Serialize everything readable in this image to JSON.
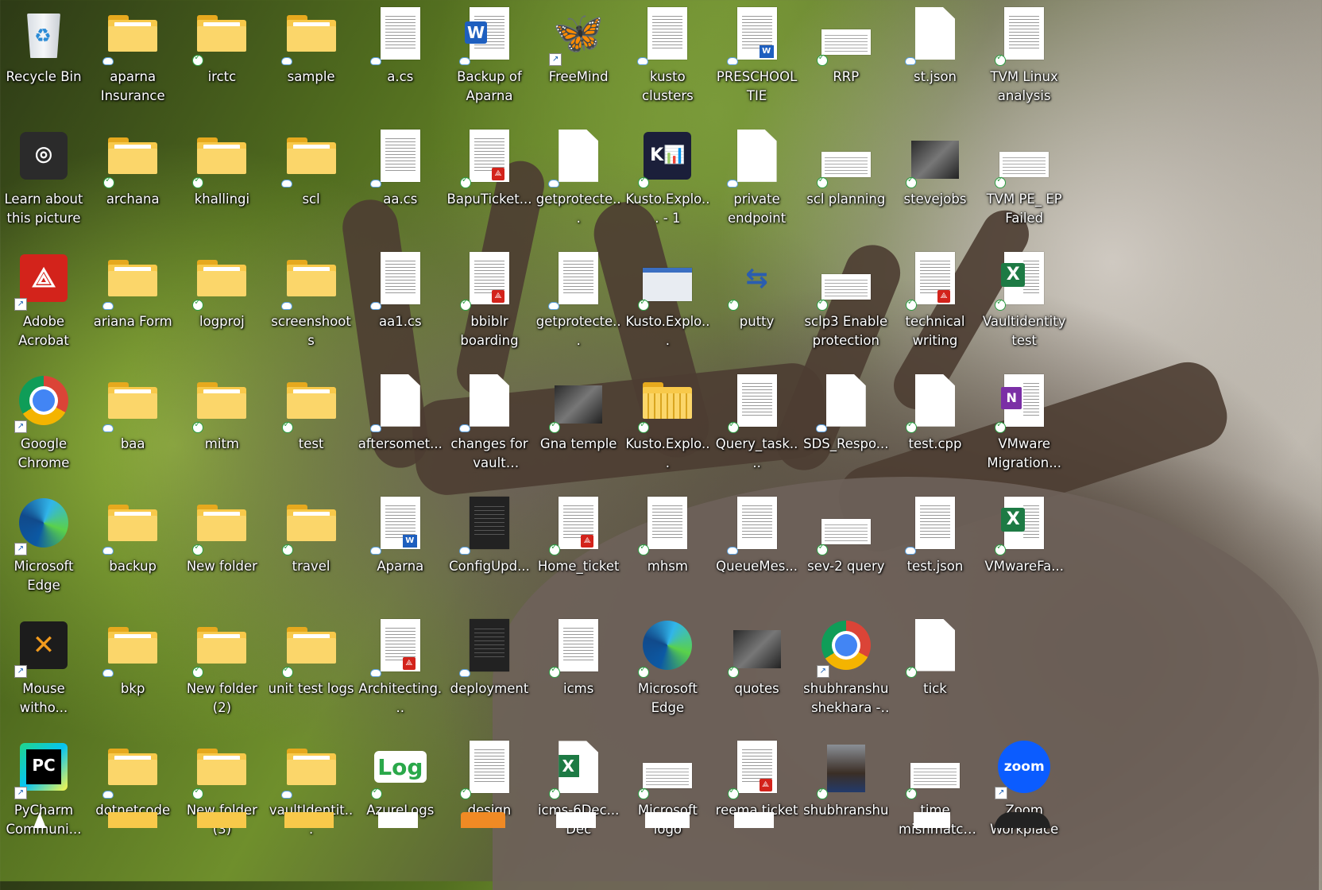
{
  "colors": {
    "label_text": "#ffffff",
    "folder": "#f8c94a",
    "sync_ok": "#2e9e44"
  },
  "icons": [
    {
      "name": "Recycle Bin",
      "type": "recycle",
      "col": 0,
      "row": 0
    },
    {
      "name": "aparna Insurance",
      "type": "folder",
      "col": 1,
      "row": 0,
      "badge": "cloud"
    },
    {
      "name": "irctc",
      "type": "folder",
      "col": 2,
      "row": 0,
      "badge": "ok"
    },
    {
      "name": "sample",
      "type": "folder",
      "col": 3,
      "row": 0,
      "badge": "cloud"
    },
    {
      "name": "a.cs",
      "type": "doc",
      "col": 4,
      "row": 0,
      "badge": "cloud"
    },
    {
      "name": "Backup of Aparna",
      "type": "word",
      "col": 5,
      "row": 0,
      "badge": "cloud"
    },
    {
      "name": "FreeMind",
      "type": "butterfly",
      "col": 6,
      "row": 0,
      "badge": "shortcut"
    },
    {
      "name": "kusto clusters",
      "type": "doc",
      "col": 7,
      "row": 0,
      "badge": "cloud"
    },
    {
      "name": "PRESCHOOL TIE",
      "type": "worddoc",
      "col": 8,
      "row": 0,
      "badge": "cloud"
    },
    {
      "name": "RRP",
      "type": "wide",
      "col": 9,
      "row": 0,
      "badge": "ok"
    },
    {
      "name": "st.json",
      "type": "blank",
      "col": 10,
      "row": 0,
      "badge": "cloud"
    },
    {
      "name": "TVM Linux analysis",
      "type": "doc",
      "col": 11,
      "row": 0,
      "badge": "ok"
    },
    {
      "name": "Learn about this picture",
      "type": "learn",
      "col": 0,
      "row": 1
    },
    {
      "name": "archana",
      "type": "folder",
      "col": 1,
      "row": 1,
      "badge": "ok"
    },
    {
      "name": "khallingi",
      "type": "folder",
      "col": 2,
      "row": 1,
      "badge": "ok"
    },
    {
      "name": "scl",
      "type": "folder",
      "col": 3,
      "row": 1,
      "badge": "cloud"
    },
    {
      "name": "aa.cs",
      "type": "doc",
      "col": 4,
      "row": 1,
      "badge": "cloud"
    },
    {
      "name": "BapuTicket...",
      "type": "pdf",
      "col": 5,
      "row": 1,
      "badge": "ok"
    },
    {
      "name": "getprotecte...",
      "type": "blank",
      "col": 6,
      "row": 1,
      "badge": "cloud"
    },
    {
      "name": "Kusto.Explo... - 1",
      "type": "kusto",
      "col": 7,
      "row": 1,
      "badge": "ok"
    },
    {
      "name": "private endpoint",
      "type": "blank",
      "col": 8,
      "row": 1,
      "badge": "cloud"
    },
    {
      "name": "scl planning",
      "type": "wide",
      "col": 9,
      "row": 1,
      "badge": "ok"
    },
    {
      "name": "stevejobs",
      "type": "photo",
      "col": 10,
      "row": 1,
      "badge": "ok"
    },
    {
      "name": "TVM PE_ EP Failed",
      "type": "wide",
      "col": 11,
      "row": 1,
      "badge": "ok"
    },
    {
      "name": "Adobe Acrobat",
      "type": "acrobat",
      "col": 0,
      "row": 2,
      "badge": "shortcut"
    },
    {
      "name": "ariana Form",
      "type": "folder",
      "col": 1,
      "row": 2,
      "badge": "cloud"
    },
    {
      "name": "logproj",
      "type": "folder",
      "col": 2,
      "row": 2,
      "badge": "ok"
    },
    {
      "name": "screenshoots",
      "type": "folder",
      "col": 3,
      "row": 2,
      "badge": "cloud"
    },
    {
      "name": "aa1.cs",
      "type": "doc",
      "col": 4,
      "row": 2,
      "badge": "cloud"
    },
    {
      "name": "bbiblr boarding",
      "type": "pdf",
      "col": 5,
      "row": 2,
      "badge": "ok"
    },
    {
      "name": "getprotecte...",
      "type": "doc",
      "col": 6,
      "row": 2,
      "badge": "cloud"
    },
    {
      "name": "Kusto.Explo...",
      "type": "window",
      "col": 7,
      "row": 2,
      "badge": "ok"
    },
    {
      "name": "putty",
      "type": "putty",
      "col": 8,
      "row": 2,
      "badge": "ok"
    },
    {
      "name": "sclp3 Enable protection",
      "type": "wide",
      "col": 9,
      "row": 2,
      "badge": "ok"
    },
    {
      "name": "technical writing",
      "type": "pdf",
      "col": 10,
      "row": 2,
      "badge": "ok"
    },
    {
      "name": "Vaultidentity test",
      "type": "excel",
      "col": 11,
      "row": 2,
      "badge": "ok"
    },
    {
      "name": "Google Chrome",
      "type": "chrome",
      "col": 0,
      "row": 3,
      "badge": "shortcut"
    },
    {
      "name": "baa",
      "type": "folder",
      "col": 1,
      "row": 3,
      "badge": "cloud"
    },
    {
      "name": "mitm",
      "type": "folder",
      "col": 2,
      "row": 3,
      "badge": "ok"
    },
    {
      "name": "test",
      "type": "folder",
      "col": 3,
      "row": 3,
      "badge": "ok"
    },
    {
      "name": "aftersomet...",
      "type": "blank",
      "col": 4,
      "row": 3,
      "badge": "cloud"
    },
    {
      "name": "changes for vault identity",
      "type": "blank",
      "col": 5,
      "row": 3,
      "badge": "cloud"
    },
    {
      "name": "Gna temple",
      "type": "photo",
      "col": 6,
      "row": 3,
      "badge": "ok"
    },
    {
      "name": "Kusto.Explo...",
      "type": "zipfolder",
      "col": 7,
      "row": 3,
      "badge": "ok"
    },
    {
      "name": "Query_task....",
      "type": "doc",
      "col": 8,
      "row": 3,
      "badge": "ok"
    },
    {
      "name": "SDS_Respo...",
      "type": "blank",
      "col": 9,
      "row": 3,
      "badge": "cloud"
    },
    {
      "name": "test.cpp",
      "type": "blank",
      "col": 10,
      "row": 3,
      "badge": "ok"
    },
    {
      "name": "VMware Migration...",
      "type": "onenote",
      "col": 11,
      "row": 3,
      "badge": "ok"
    },
    {
      "name": "Microsoft Edge",
      "type": "edge",
      "col": 0,
      "row": 4,
      "badge": "shortcut"
    },
    {
      "name": "backup",
      "type": "folder",
      "col": 1,
      "row": 4,
      "badge": "cloud"
    },
    {
      "name": "New folder",
      "type": "folder",
      "col": 2,
      "row": 4,
      "badge": "ok"
    },
    {
      "name": "travel",
      "type": "folder",
      "col": 3,
      "row": 4,
      "badge": "ok"
    },
    {
      "name": "Aparna",
      "type": "worddoc",
      "col": 4,
      "row": 4,
      "badge": "cloud"
    },
    {
      "name": "ConfigUpd...",
      "type": "darkdoc",
      "col": 5,
      "row": 4,
      "badge": "cloud"
    },
    {
      "name": "Home_ticket",
      "type": "pdf",
      "col": 6,
      "row": 4,
      "badge": "ok"
    },
    {
      "name": "mhsm",
      "type": "doc",
      "col": 7,
      "row": 4,
      "badge": "ok"
    },
    {
      "name": "QueueMes...",
      "type": "doc",
      "col": 8,
      "row": 4,
      "badge": "cloud"
    },
    {
      "name": "sev-2 query",
      "type": "wide",
      "col": 9,
      "row": 4,
      "badge": "ok"
    },
    {
      "name": "test.json",
      "type": "doc",
      "col": 10,
      "row": 4,
      "badge": "cloud"
    },
    {
      "name": "VMwareFa...",
      "type": "excel",
      "col": 11,
      "row": 4,
      "badge": "ok"
    },
    {
      "name": "Mouse witho...",
      "type": "mouse",
      "col": 0,
      "row": 5,
      "badge": "shortcut"
    },
    {
      "name": "bkp",
      "type": "folder",
      "col": 1,
      "row": 5,
      "badge": "cloud"
    },
    {
      "name": "New folder (2)",
      "type": "folder",
      "col": 2,
      "row": 5,
      "badge": "ok"
    },
    {
      "name": "unit test logs",
      "type": "folder",
      "col": 3,
      "row": 5,
      "badge": "ok"
    },
    {
      "name": "Architecting...",
      "type": "pdf",
      "col": 4,
      "row": 5,
      "badge": "cloud"
    },
    {
      "name": "deployment",
      "type": "darkdoc",
      "col": 5,
      "row": 5,
      "badge": "cloud"
    },
    {
      "name": "icms",
      "type": "doc",
      "col": 6,
      "row": 5,
      "badge": "ok"
    },
    {
      "name": "Microsoft Edge",
      "type": "edge",
      "col": 7,
      "row": 5,
      "badge": "ok"
    },
    {
      "name": "quotes",
      "type": "photo",
      "col": 8,
      "row": 5,
      "badge": "ok"
    },
    {
      "name": "shubhranshu shekhara - ...",
      "type": "chrome",
      "col": 9,
      "row": 5,
      "badge": "shortcut"
    },
    {
      "name": "tick",
      "type": "blank",
      "col": 10,
      "row": 5,
      "badge": "ok"
    },
    {
      "name": "PyCharm Communi...",
      "type": "pycharm",
      "col": 0,
      "row": 6,
      "badge": "shortcut"
    },
    {
      "name": "dotnetcode",
      "type": "folder",
      "col": 1,
      "row": 6,
      "badge": "cloud"
    },
    {
      "name": "New folder (3)",
      "type": "folder",
      "col": 2,
      "row": 6,
      "badge": "ok"
    },
    {
      "name": "vaultIdentit...",
      "type": "folder",
      "col": 3,
      "row": 6,
      "badge": "cloud"
    },
    {
      "name": "AzureLogs",
      "type": "azurelog",
      "col": 4,
      "row": 6,
      "badge": "ok"
    },
    {
      "name": "design",
      "type": "doc",
      "col": 5,
      "row": 6,
      "badge": "ok"
    },
    {
      "name": "icms-6Dec... Dec",
      "type": "exceldoc",
      "col": 6,
      "row": 6,
      "badge": "ok"
    },
    {
      "name": "Microsoft logo",
      "type": "wide",
      "col": 7,
      "row": 6,
      "badge": "ok"
    },
    {
      "name": "reema ticket",
      "type": "pdf",
      "col": 8,
      "row": 6,
      "badge": "ok"
    },
    {
      "name": "shubhranshu",
      "type": "portrait",
      "col": 9,
      "row": 6,
      "badge": "ok"
    },
    {
      "name": "time mishmatch ...",
      "type": "wide",
      "col": 10,
      "row": 6,
      "badge": "ok"
    },
    {
      "name": "Zoom Workplace",
      "type": "zoom",
      "col": 11,
      "row": 6,
      "badge": "shortcut"
    }
  ]
}
